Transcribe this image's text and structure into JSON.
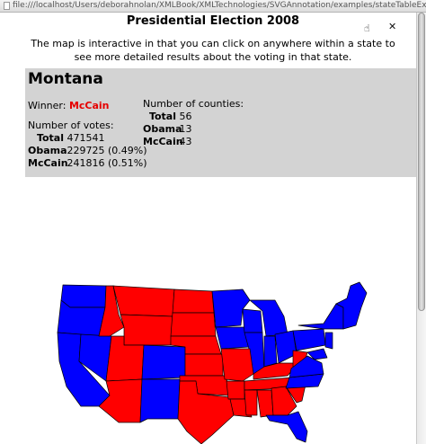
{
  "browser": {
    "url": "file:///localhost/Users/deborahnolan/XMLBook/XMLTechnologies/SVGAnnotation/examples/stateTableEx.html"
  },
  "page": {
    "title": "Presidential Election 2008",
    "intro": "The map is interactive in that you can click on anywhere within a state to see more detailed results about the voting in that state."
  },
  "state_panel": {
    "state": "Montana",
    "winner_label": "Winner:",
    "winner": "McCain",
    "votes_heading": "Number of votes:",
    "votes": [
      {
        "label": "Total",
        "value": "471541"
      },
      {
        "label": "Obama",
        "value": "229725 (0.49%)"
      },
      {
        "label": "McCain",
        "value": "241816 (0.51%)"
      }
    ],
    "counties_heading": "Number of counties:",
    "counties": [
      {
        "label": "Total",
        "value": "56"
      },
      {
        "label": "Obama",
        "value": "13"
      },
      {
        "label": "McCain",
        "value": "43"
      }
    ]
  },
  "map": {
    "colors": {
      "democrat": "#0000ff",
      "republican": "#ff0000",
      "border": "#000000"
    }
  },
  "icons": [
    "document-icon",
    "close-icon",
    "cursor-icon"
  ]
}
